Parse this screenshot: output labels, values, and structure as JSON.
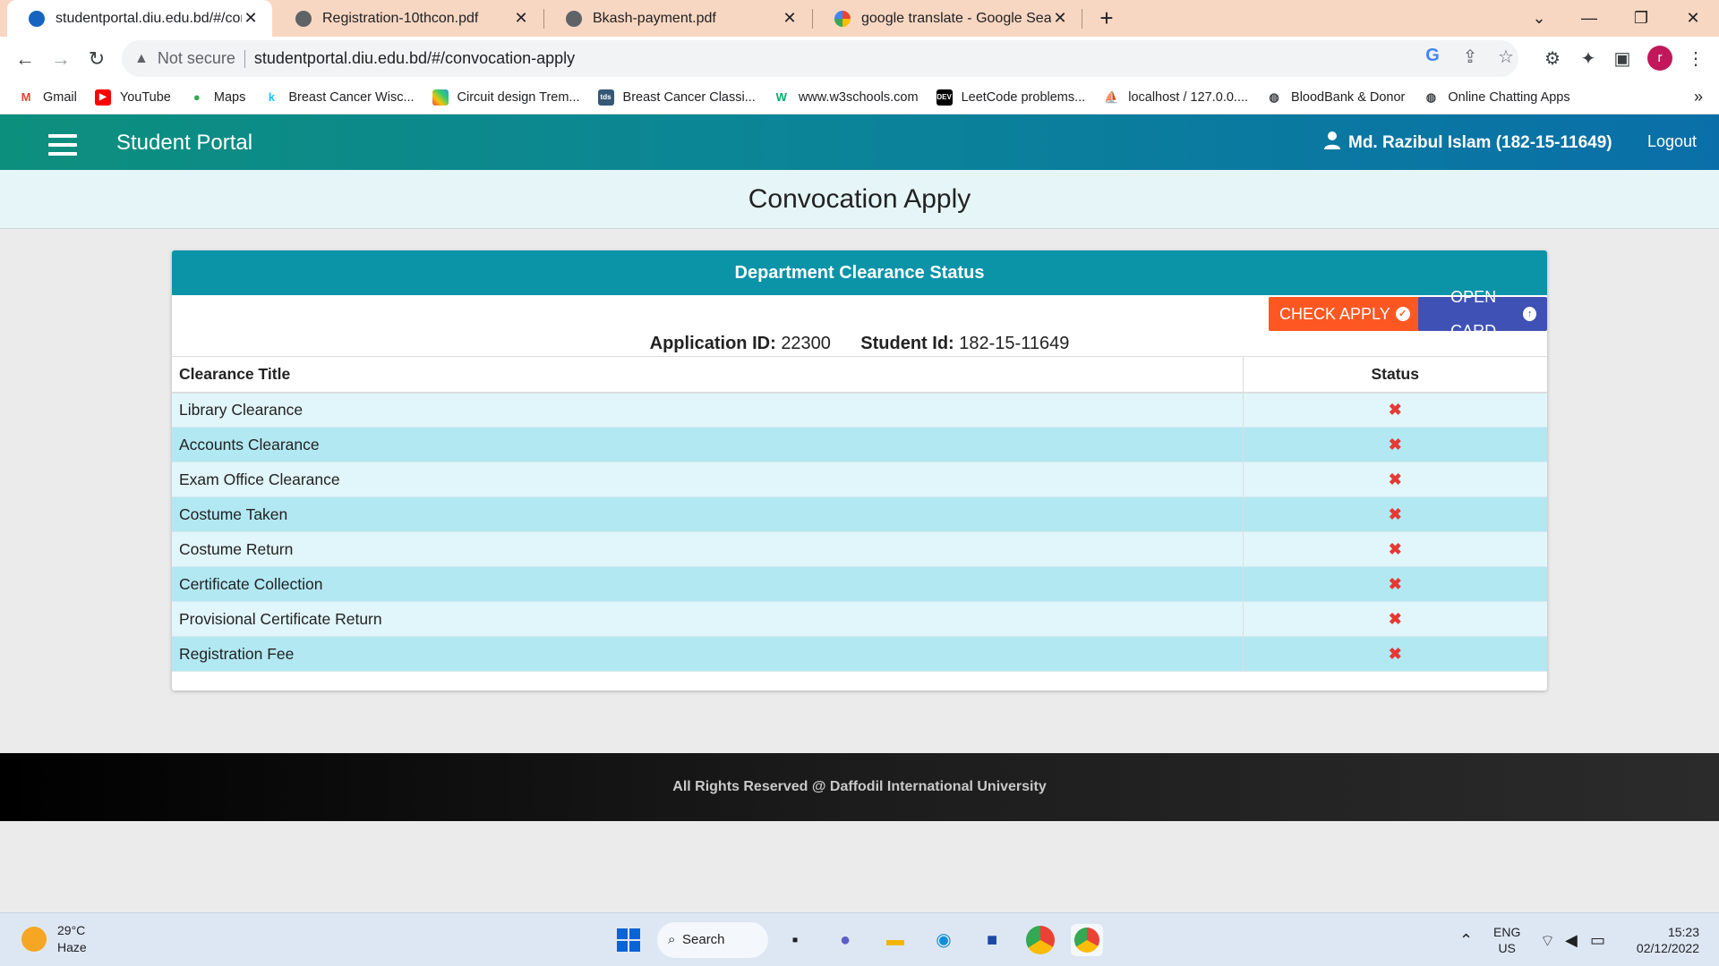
{
  "browser": {
    "tabs": [
      {
        "title": "studentportal.diu.edu.bd/#/conv",
        "active": true,
        "icon": "diu-favicon"
      },
      {
        "title": "Registration-10thcon.pdf",
        "active": false,
        "icon": "globe-icon"
      },
      {
        "title": "Bkash-payment.pdf",
        "active": false,
        "icon": "globe-icon"
      },
      {
        "title": "google translate - Google Search",
        "active": false,
        "icon": "google-icon"
      }
    ],
    "new_tab": "+",
    "address": {
      "security": "Not secure",
      "url": "studentportal.diu.edu.bd/#/convocation-apply"
    },
    "profile_initial": "r",
    "bookmarks": [
      {
        "label": "Gmail",
        "icon": "gmail-icon"
      },
      {
        "label": "YouTube",
        "icon": "youtube-icon"
      },
      {
        "label": "Maps",
        "icon": "maps-icon"
      },
      {
        "label": "Breast Cancer Wisc...",
        "icon": "kaggle-icon"
      },
      {
        "label": "Circuit design Trem...",
        "icon": "tinkercad-icon"
      },
      {
        "label": "Breast Cancer Classi...",
        "icon": "tds-icon"
      },
      {
        "label": "www.w3schools.com",
        "icon": "w3schools-icon"
      },
      {
        "label": "LeetCode problems...",
        "icon": "dev-icon"
      },
      {
        "label": "localhost / 127.0.0....",
        "icon": "phpmyadmin-icon"
      },
      {
        "label": "BloodBank & Donor",
        "icon": "globe-icon"
      },
      {
        "label": "Online Chatting Apps",
        "icon": "globe-icon"
      }
    ],
    "bookmarks_more": "»"
  },
  "app": {
    "brand": "Student Portal",
    "user": "Md. Razibul Islam (182-15-11649)",
    "logout": "Logout",
    "page_title": "Convocation Apply",
    "card_title": "Department Clearance Status",
    "buttons": {
      "check_apply": "CHECK APPLY",
      "open_card": "OPEN CARD"
    },
    "application_id_label": "Application ID:",
    "application_id": "22300",
    "student_id_label": "Student Id:",
    "student_id": "182-15-11649",
    "table": {
      "headers": [
        "Clearance Title",
        "Status"
      ],
      "rows": [
        {
          "title": "Library Clearance",
          "status": "✖"
        },
        {
          "title": "Accounts Clearance",
          "status": "✖"
        },
        {
          "title": "Exam Office Clearance",
          "status": "✖"
        },
        {
          "title": "Costume Taken",
          "status": "✖"
        },
        {
          "title": "Costume Return",
          "status": "✖"
        },
        {
          "title": "Certificate Collection",
          "status": "✖"
        },
        {
          "title": "Provisional Certificate Return",
          "status": "✖"
        },
        {
          "title": "Registration Fee",
          "status": "✖"
        }
      ]
    },
    "footer": "All Rights Reserved @ Daffodil International University",
    "colors": {
      "header_start": "#0d8f7d",
      "header_end": "#0a6fa8",
      "card_head": "#0b93a8",
      "check_apply": "#ff5722",
      "open_card": "#3f51b5",
      "status_fail": "#e53935"
    }
  },
  "taskbar": {
    "weather_temp": "29°C",
    "weather_desc": "Haze",
    "search_label": "Search",
    "lang": "ENG",
    "region": "US",
    "time": "15:23",
    "date": "02/12/2022"
  }
}
